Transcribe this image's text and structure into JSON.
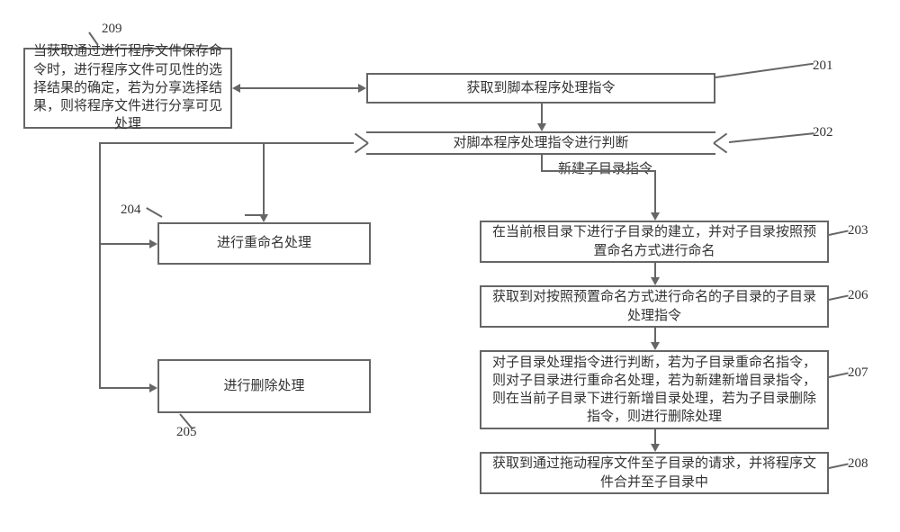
{
  "nodes": {
    "n201": {
      "text": "获取到脚本程序处理指令",
      "label": "201"
    },
    "n202": {
      "text": "对脚本程序处理指令进行判断",
      "label": "202"
    },
    "branch_label": "新建子目录指令",
    "n203": {
      "text": "在当前根目录下进行子目录的建立，并对子目录按照预置命名方式进行命名",
      "label": "203"
    },
    "n204": {
      "text": "进行重命名处理",
      "label": "204"
    },
    "n205": {
      "text": "进行删除处理",
      "label": "205"
    },
    "n206": {
      "text": "获取到对按照预置命名方式进行命名的子目录的子目录处理指令",
      "label": "206"
    },
    "n207": {
      "text": "对子目录处理指令进行判断，若为子目录重命名指令，则对子目录进行重命名处理，若为新建新增目录指令，则在当前子目录下进行新增目录处理，若为子目录删除指令，则进行删除处理",
      "label": "207"
    },
    "n208": {
      "text": "获取到通过拖动程序文件至子目录的请求，并将程序文件合并至子目录中",
      "label": "208"
    },
    "n209": {
      "text": "当获取通过进行程序文件保存命令时，进行程序文件可见性的选择结果的确定，若为分享选择结果，则将程序文件进行分享可见处理",
      "label": "209"
    }
  }
}
